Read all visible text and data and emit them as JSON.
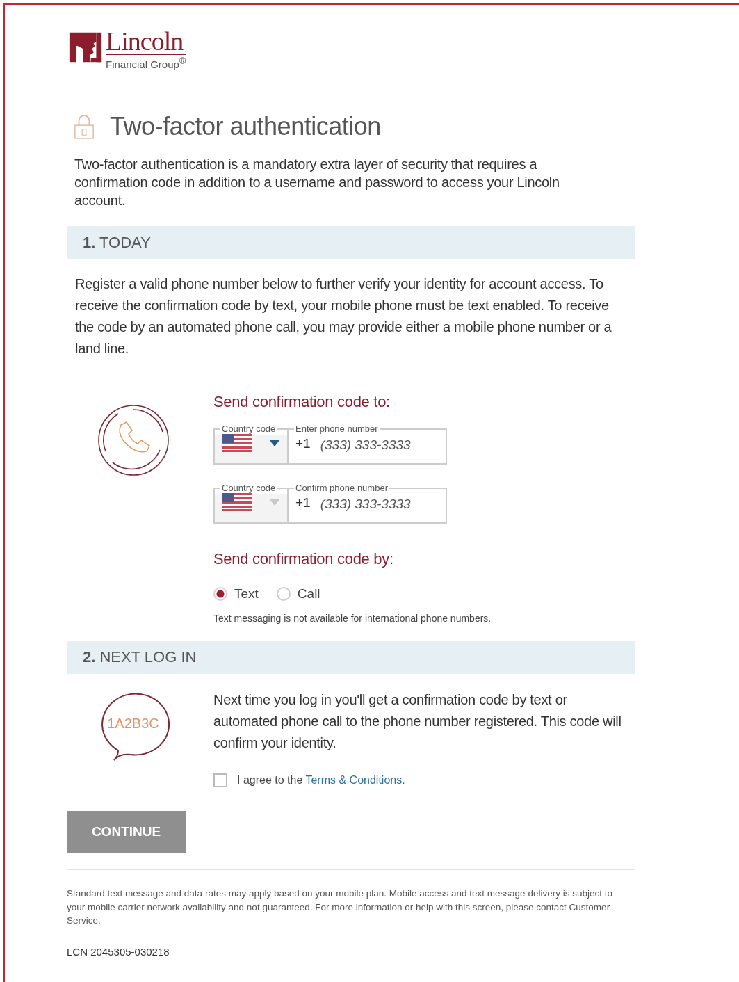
{
  "logo": {
    "name": "Lincoln",
    "tagline": "Financial Group$^{®}$"
  },
  "title": "Two-factor authentication",
  "intro": "Two-factor authentication is a mandatory extra layer of security that requires a confirmation code in addition to a username and password to access your Lincoln account.",
  "sections": [
    {
      "heading": "**1.** TODAY",
      "text": "Register a valid phone number below to further verify your identity for account access. To receive the confirmation code by text, your mobile phone must be text enabled. To receive the code by an automated phone call, you may provide either a mobile phone number or a land line."
    },
    {
      "heading": "**2.** NEXT LOG IN",
      "text": "Next time you log in you'll get a confirmation code by text or automated phone call to the phone number registered. This code will confirm your identity."
    }
  ],
  "send_to": {
    "label": "Send confirmation code to:",
    "fields": [
      {
        "country_label": "Country code",
        "phone_label": "Enter phone number",
        "prefix": "+1",
        "placeholder": "(333) 333-3333",
        "disabled": false
      },
      {
        "country_label": "Country code",
        "phone_label": "Confirm phone number",
        "prefix": "+1",
        "placeholder": "(333) 333-3333",
        "disabled": true
      }
    ]
  },
  "send_by": {
    "label": "Send confirmation code by:",
    "options": [
      {
        "label": "Text",
        "selected": true
      },
      {
        "label": "Call",
        "selected": false
      }
    ],
    "note": "Text messaging is not available for international phone numbers."
  },
  "code_badge": "1A2B3C",
  "agree": {
    "text": "I agree to the",
    "link": "Terms & Conditions.",
    "checked": false
  },
  "continue": {
    "label": "CONTINUE",
    "disabled": true
  },
  "footer": "Standard text message and data rates may apply based on your mobile plan. Mobile access and text message delivery is subject to your mobile carrier network availability and not guaranteed. For more information or help with this screen, please contact Customer Service.",
  "code": "LCN 2045305-030218"
}
